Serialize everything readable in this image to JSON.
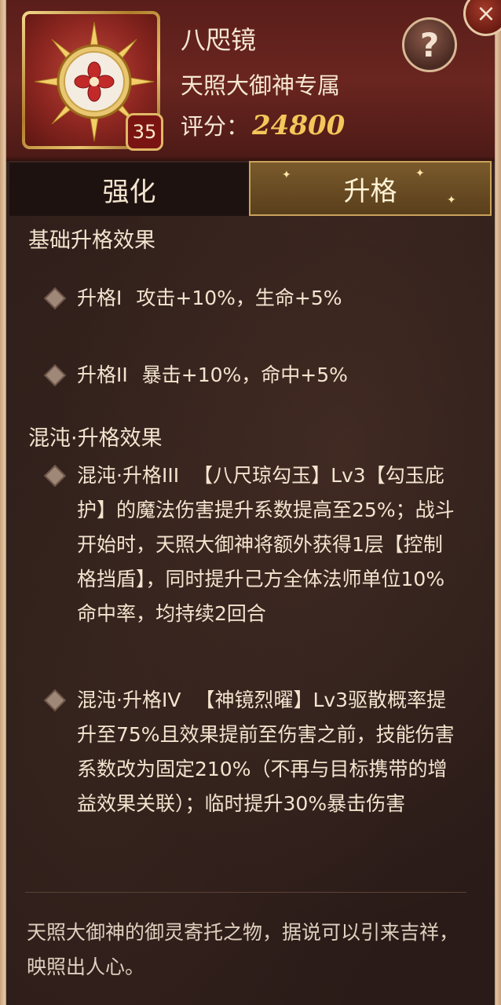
{
  "item": {
    "name": "八咫镜",
    "exclusive": "天照大御神专属",
    "score_label": "评分：",
    "score_value": "24800",
    "level": "35"
  },
  "buttons": {
    "help": "?",
    "close": "×"
  },
  "tabs": [
    {
      "label": "强化",
      "selected": false
    },
    {
      "label": "升格",
      "selected": true
    }
  ],
  "sections": {
    "basic_title": "基础升格效果",
    "basic_items": [
      {
        "name": "升格I",
        "text": "攻击+10%，生命+5%"
      },
      {
        "name": "升格II",
        "text": "暴击+10%，命中+5%"
      }
    ],
    "chaos_title": "混沌·升格效果",
    "chaos_items": [
      {
        "name": "混沌·升格III",
        "text": "【八尺琼勾玉】Lv3【勾玉庇护】的魔法伤害提升系数提高至25%；战斗开始时，天照大御神将额外获得1层【控制格挡盾】，同时提升己方全体法师单位10%命中率，均持续2回合"
      },
      {
        "name": "混沌·升格IV",
        "text": "【神镜烈曜】Lv3驱散概率提升至75%且效果提前至伤害之前，技能伤害系数改为固定210%（不再与目标携带的增益效果关联）；临时提升30%暴击伤害"
      }
    ]
  },
  "flavor_text": "天照大御神的御灵寄托之物，据说可以引来吉祥，映照出人心。",
  "colors": {
    "score": "#f5c65a",
    "text": "#f3e4cf",
    "header_bg": "#5a1e1a",
    "tab_selected": "#7a5a2c"
  }
}
